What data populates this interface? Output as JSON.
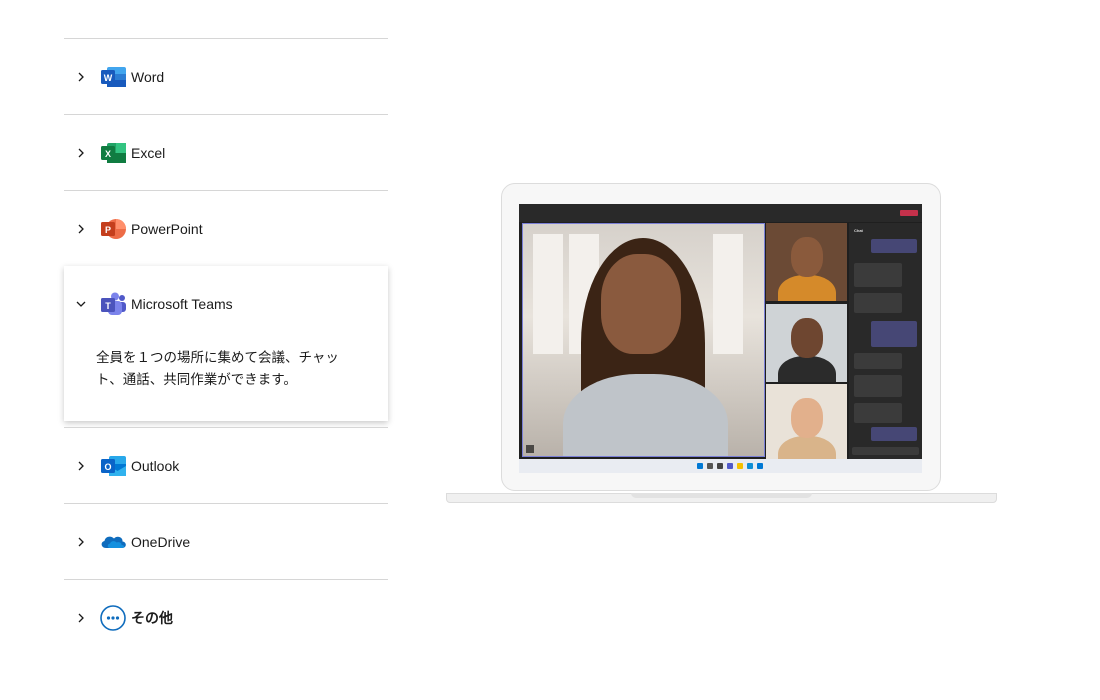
{
  "accordion": {
    "items": [
      {
        "id": "word",
        "label": "Word",
        "icon": "word-icon",
        "expanded": false
      },
      {
        "id": "excel",
        "label": "Excel",
        "icon": "excel-icon",
        "expanded": false
      },
      {
        "id": "powerpoint",
        "label": "PowerPoint",
        "icon": "powerpoint-icon",
        "expanded": false
      },
      {
        "id": "teams",
        "label": "Microsoft Teams",
        "icon": "teams-icon",
        "expanded": true,
        "description": "全員を１つの場所に集めて会議、チャット、通話、共同作業ができます。"
      },
      {
        "id": "outlook",
        "label": "Outlook",
        "icon": "outlook-icon",
        "expanded": false
      },
      {
        "id": "onedrive",
        "label": "OneDrive",
        "icon": "onedrive-icon",
        "expanded": false
      },
      {
        "id": "other",
        "label": "その他",
        "icon": "more-icon",
        "expanded": false
      }
    ]
  },
  "colors": {
    "word": "#185abd",
    "excel": "#107c41",
    "powerpoint": "#c43e1c",
    "teams": "#5059c9",
    "outlook": "#0a64c8",
    "onedrive": "#0f6cbd",
    "more": "#0f6cbd"
  },
  "laptop_screen": {
    "app": "Microsoft Teams meeting",
    "chat_header": "Chat"
  }
}
